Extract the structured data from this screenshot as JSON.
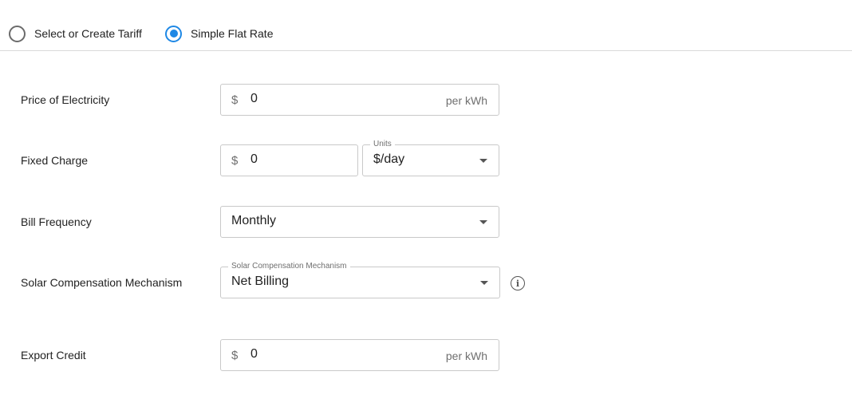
{
  "tariff_mode": {
    "options": [
      {
        "label": "Select or Create Tariff",
        "selected": false
      },
      {
        "label": "Simple Flat Rate",
        "selected": true
      }
    ]
  },
  "form": {
    "price_of_electricity": {
      "label": "Price of Electricity",
      "prefix": "$",
      "value": "0",
      "suffix": "per kWh"
    },
    "fixed_charge": {
      "label": "Fixed Charge",
      "prefix": "$",
      "value": "0",
      "units_label": "Units",
      "units_value": "$/day"
    },
    "bill_frequency": {
      "label": "Bill Frequency",
      "value": "Monthly"
    },
    "solar_compensation": {
      "label": "Solar Compensation Mechanism",
      "field_label": "Solar Compensation Mechanism",
      "value": "Net Billing",
      "info_icon": "info-icon"
    },
    "export_credit": {
      "label": "Export Credit",
      "prefix": "$",
      "value": "0",
      "suffix": "per kWh"
    }
  },
  "colors": {
    "accent": "#1e88e5",
    "border": "#c9c9c9",
    "muted_text": "#6f6f6f"
  }
}
